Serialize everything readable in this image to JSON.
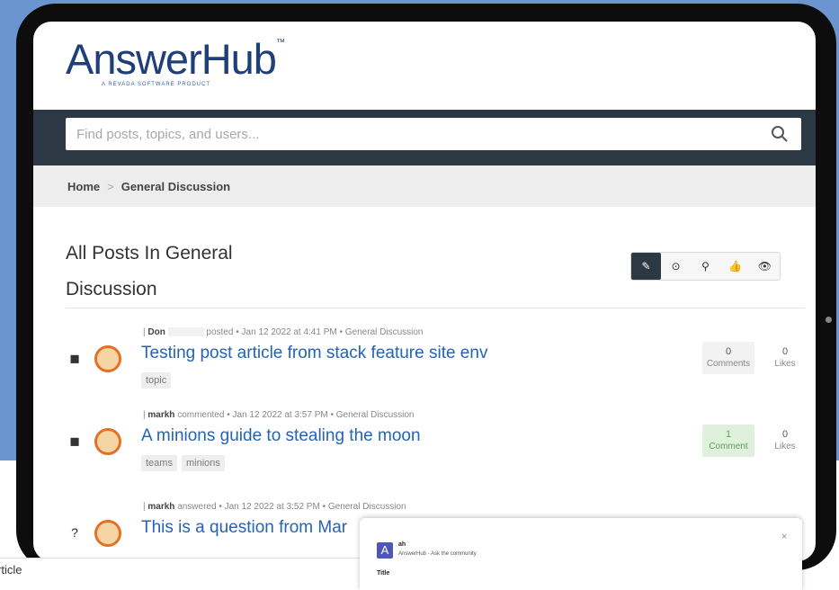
{
  "brand": {
    "logo_text": "AnswerHub",
    "logo_mark": "™",
    "tagline": "A REVADA SOFTWARE PRODUCT"
  },
  "search": {
    "placeholder": "Find posts, topics, and users..."
  },
  "breadcrumb": {
    "home": "Home",
    "separator": ">",
    "current": "General Discussion"
  },
  "page": {
    "title_line1": "All Posts In General",
    "title_line2": "Discussion"
  },
  "filters": [
    {
      "icon": "edit-icon",
      "glyph": "✎",
      "active": true
    },
    {
      "icon": "clock-icon",
      "glyph": "⊙",
      "active": false
    },
    {
      "icon": "pin-icon",
      "glyph": "⚲",
      "active": false
    },
    {
      "icon": "thumbs-up-icon",
      "glyph": "👍",
      "active": false
    },
    {
      "icon": "eye-icon",
      "glyph": "👁",
      "active": false
    }
  ],
  "posts": [
    {
      "type_icon": "article-icon",
      "type_glyph": "◼",
      "user": "Don",
      "action": "posted",
      "date": "Jan 12 2022 at 4:41 PM",
      "space": "General Discussion",
      "title": "Testing post article from stack feature site env",
      "tags": [
        "topic"
      ],
      "comments_count": "0",
      "comments_label": "Comments",
      "likes_count": "0",
      "likes_label": "Likes",
      "has_comments": false
    },
    {
      "type_icon": "article-icon",
      "type_glyph": "◼",
      "user": "markh",
      "action": "commented",
      "date": "Jan 12 2022 at 3:57 PM",
      "space": "General Discussion",
      "title": "A minions guide to stealing the moon",
      "tags": [
        "teams",
        "minions"
      ],
      "comments_count": "1",
      "comments_label": "Comment",
      "likes_count": "0",
      "likes_label": "Likes",
      "has_comments": true
    },
    {
      "type_icon": "question-icon",
      "type_glyph": "?",
      "user": "markh",
      "action": "answered",
      "date": "Jan 12 2022 at 3:52 PM",
      "space": "General Discussion",
      "title": "This is a question from Mar",
      "tags": [],
      "has_comments": false
    }
  ],
  "meta_separator": "•",
  "bottom_field": {
    "value": "rticle"
  },
  "teams_card": {
    "app_badge": "A",
    "app_name": "ah",
    "app_subtitle": "AnswerHub - Ask the community",
    "field_label": "Title",
    "close_glyph": "×"
  },
  "colors": {
    "background_blue": "#6b95cf",
    "nav_dark": "#2c3945",
    "link_blue": "#2563b5",
    "comment_green": "#dff1dc",
    "avatar_orange": "#e57028"
  }
}
